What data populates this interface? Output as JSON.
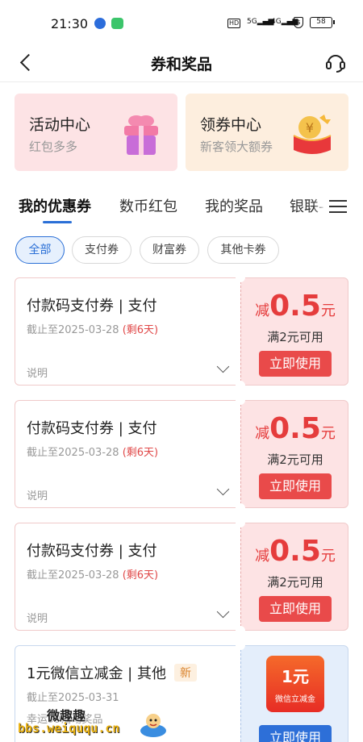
{
  "status_bar": {
    "time": "21:30",
    "hd": "HD",
    "signal1": "5G",
    "signal2": "4G",
    "battery": "58"
  },
  "header": {
    "title": "券和奖品"
  },
  "top_cards": [
    {
      "title": "活动中心",
      "subtitle": "红包多多",
      "icon": "gift-box-icon"
    },
    {
      "title": "领券中心",
      "subtitle": "新客领大额券",
      "icon": "red-envelope-icon"
    }
  ],
  "tabs": [
    {
      "label": "我的优惠券",
      "active": true
    },
    {
      "label": "数币红包",
      "active": false
    },
    {
      "label": "我的奖品",
      "active": false
    },
    {
      "label": "银联-",
      "active": false
    }
  ],
  "filters": [
    {
      "label": "全部",
      "active": true
    },
    {
      "label": "支付券",
      "active": false
    },
    {
      "label": "财富券",
      "active": false
    },
    {
      "label": "其他卡券",
      "active": false
    }
  ],
  "coupons": [
    {
      "name": "付款码支付券 | 支付",
      "expiry": "截止至2025-03-28",
      "days_left": "(剩6天)",
      "note": "说明",
      "prefix": "减",
      "amount": "0.5",
      "unit": "元",
      "condition": "满2元可用",
      "button": "立即使用"
    },
    {
      "name": "付款码支付券 | 支付",
      "expiry": "截止至2025-03-28",
      "days_left": "(剩6天)",
      "note": "说明",
      "prefix": "减",
      "amount": "0.5",
      "unit": "元",
      "condition": "满2元可用",
      "button": "立即使用"
    },
    {
      "name": "付款码支付券 | 支付",
      "expiry": "截止至2025-03-28",
      "days_left": "(剩6天)",
      "note": "说明",
      "prefix": "减",
      "amount": "0.5",
      "unit": "元",
      "condition": "满2元可用",
      "button": "立即使用"
    }
  ],
  "coupon4": {
    "name": "1元微信立减金 | 其他",
    "badge": "新",
    "expiry": "截止至2025-03-31",
    "source": "幸运99活动奖品",
    "redpack_value": "1元",
    "redpack_label": "微信立减金",
    "button": "立即使用"
  },
  "watermark": {
    "top": "微趣趣",
    "bottom": "bbs.weiququ.cn"
  },
  "colors": {
    "accent_blue": "#2a6fd6",
    "accent_red": "#e94a4a",
    "coupon_pink": "#fde3e4"
  }
}
